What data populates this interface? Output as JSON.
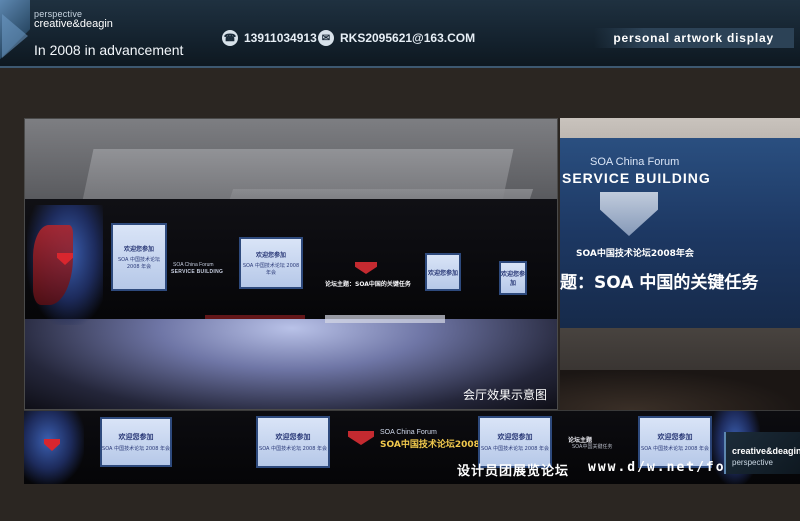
{
  "header": {
    "brand_small": "perspective",
    "brand_main": "creative&deagin",
    "title": "In 2008 in advancement",
    "phone": "13911034913",
    "email": "RKS2095621@163.COM",
    "tagline": "personal artwork display",
    "phone_icon": "phone-icon",
    "email_icon": "mail-icon"
  },
  "stage": {
    "screen_welcome": "欢迎您参加",
    "screen_forum": "SOA 中国技术论坛 2008 年会",
    "left_caption_small": "SOA China Forum",
    "left_caption_main": "SERVICE BUILDING",
    "center_text": "论坛主题：SOA中国的关键任务",
    "caption": "会厅效果示意图"
  },
  "photo": {
    "forum": "SOA China Forum",
    "title": "SERVICE BUILDING",
    "year": "SOA中国技术论坛2008年会",
    "theme": "题：SOA 中国的关键任务"
  },
  "strip": {
    "screen_welcome": "欢迎您参加",
    "screen_forum": "SOA 中国技术论坛 2008 年会",
    "forum_en": "SOA China Forum",
    "forum_cn": "SOA中国技术论坛2008",
    "theme_title": "论坛主题",
    "theme_sub": "SOA中国关键任务"
  },
  "watermark": {
    "cn": "设计员团展览论坛",
    "url": "www.d/w.net/forum"
  },
  "corner": {
    "brand": "creative&deagin",
    "sub": "perspective"
  },
  "colors": {
    "header_bg": "#14222e",
    "accent": "#5d87b0",
    "page_bg": "#2b2622",
    "screen_blue": "#b6c8e8",
    "logo_red": "#c42a30"
  }
}
